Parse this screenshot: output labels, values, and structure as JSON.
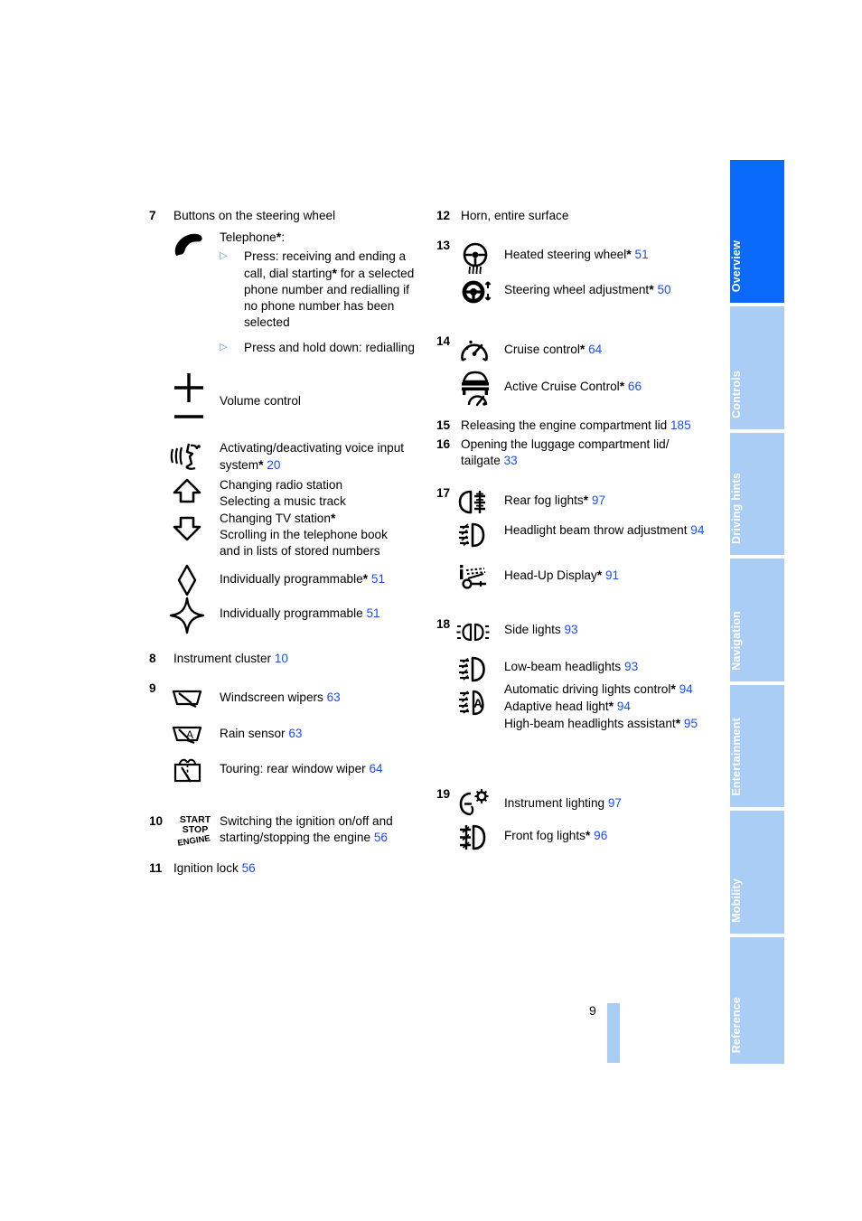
{
  "document": {
    "page_number": "9"
  },
  "sidebar": {
    "tabs": [
      {
        "label": "Overview",
        "active": true,
        "bg": "#0a6bfa",
        "color": "#ffffff"
      },
      {
        "label": "Controls",
        "active": false,
        "bg": "#aacdf5",
        "color": "#ffffff"
      },
      {
        "label": "Driving hints",
        "active": false,
        "bg": "#aacdf5",
        "color": "#ffffff"
      },
      {
        "label": "Navigation",
        "active": false,
        "bg": "#aacdf5",
        "color": "#ffffff"
      },
      {
        "label": "Entertainment",
        "active": false,
        "bg": "#aacdf5",
        "color": "#ffffff"
      },
      {
        "label": "Mobility",
        "active": false,
        "bg": "#aacdf5",
        "color": "#ffffff"
      },
      {
        "label": "Reference",
        "active": false,
        "bg": "#aacdf5",
        "color": "#ffffff"
      }
    ]
  },
  "colors": {
    "page_ref_blue": "#1a4cff",
    "tab_active": "#0a6bfa",
    "tab_inactive": "#aacdf5",
    "bullet_blue": "#5a9bd5"
  },
  "left_column": {
    "item7": {
      "number": "7",
      "title": "Buttons on the steering wheel",
      "telephone_label": "Telephone",
      "telephone_star": "*",
      "telephone_colon": ":",
      "press_1": "Press: receiving and ending a call, dial starting",
      "press_1_star": "*",
      "press_1_tail": " for a selected phone number and redialling if no phone number has been selected",
      "press_2": "Press and hold down: redialling",
      "volume_label": "Volume control",
      "voice_label": "Activating/deactivating voice input system",
      "voice_star": "*",
      "voice_page": "20",
      "radio_line1": "Changing radio station",
      "radio_line2": "Selecting a music track",
      "radio_line3": "Changing TV station",
      "radio_line3_star": "*",
      "radio_line4": "Scrolling in the telephone book",
      "radio_line5": "and in lists of stored numbers",
      "prog1_label": "Individually programmable",
      "prog1_star": "*",
      "prog1_page": "51",
      "prog2_label": "Individually programmable",
      "prog2_page": "51"
    },
    "item8": {
      "number": "8",
      "label": "Instrument cluster",
      "page": "10"
    },
    "item9": {
      "number": "9",
      "wipers_label": "Windscreen wipers",
      "wipers_page": "63",
      "rain_label": "Rain sensor",
      "rain_page": "63",
      "touring_label": "Touring: rear window wiper",
      "touring_page": "64"
    },
    "item10": {
      "number": "10",
      "icon_line1": "START",
      "icon_line2": "STOP",
      "icon_line3": "ENGINE",
      "label": "Switching the ignition on/off and starting/stopping the engine",
      "page": "56"
    },
    "item11": {
      "number": "11",
      "label": "Ignition lock",
      "page": "56"
    }
  },
  "right_column": {
    "item12": {
      "number": "12",
      "label": "Horn, entire surface"
    },
    "item13": {
      "number": "13",
      "heated_label": "Heated steering wheel",
      "heated_star": "*",
      "heated_page": "51",
      "adjust_label": "Steering wheel adjustment",
      "adjust_star": "*",
      "adjust_page": "50"
    },
    "item14": {
      "number": "14",
      "cruise_label": "Cruise control",
      "cruise_star": "*",
      "cruise_page": "64",
      "acc_label": "Active Cruise Control",
      "acc_star": "*",
      "acc_page": "66"
    },
    "item15": {
      "number": "15",
      "label": "Releasing the engine compartment lid",
      "page": "185"
    },
    "item16": {
      "number": "16",
      "label": "Opening the luggage compartment lid/ tailgate",
      "page": "33"
    },
    "item17": {
      "number": "17",
      "rear_fog_label": "Rear fog lights",
      "rear_fog_star": "*",
      "rear_fog_page": "97",
      "beam_label": "Headlight beam throw adjustment",
      "beam_page": "94",
      "hud_label": "Head-Up Display",
      "hud_star": "*",
      "hud_page": "91"
    },
    "item18": {
      "number": "18",
      "side_label": "Side lights",
      "side_page": "93",
      "lowbeam_label": "Low-beam headlights",
      "lowbeam_page": "93",
      "auto_label": "Automatic driving lights control",
      "auto_star": "*",
      "auto_page": "94",
      "adaptive_label": "Adaptive head light",
      "adaptive_star": "*",
      "adaptive_page": "94",
      "highbeam_label": "High-beam headlights assistant",
      "highbeam_star": "*",
      "highbeam_page": "95"
    },
    "item19": {
      "number": "19",
      "instr_label": "Instrument lighting",
      "instr_page": "97",
      "front_fog_label": "Front fog lights",
      "front_fog_star": "*",
      "front_fog_page": "96"
    }
  }
}
